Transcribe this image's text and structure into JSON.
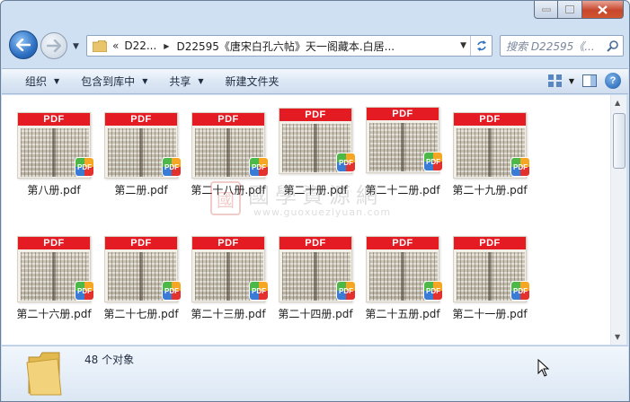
{
  "window": {
    "title_controls": {
      "minimize": "minimize",
      "maximize": "maximize",
      "close": "close"
    }
  },
  "nav": {
    "breadcrumb_overflow": "«",
    "breadcrumbs": [
      "D22...",
      "D22595《唐宋白孔六帖》天一阁藏本.白居..."
    ],
    "search_placeholder": "搜索 D22595《..."
  },
  "toolbar": {
    "items": [
      {
        "label": "组织",
        "has_menu": true
      },
      {
        "label": "包含到库中",
        "has_menu": true
      },
      {
        "label": "共享",
        "has_menu": true
      },
      {
        "label": "新建文件夹",
        "has_menu": false
      }
    ]
  },
  "files": [
    {
      "name": "第八册.pdf",
      "thumb_label": "PDF"
    },
    {
      "name": "第二册.pdf",
      "thumb_label": "PDF"
    },
    {
      "name": "第二十八册.pdf",
      "thumb_label": "PDF"
    },
    {
      "name": "第二十册.pdf",
      "thumb_label": "PDF"
    },
    {
      "name": "第二十二册.pdf",
      "thumb_label": "PDF"
    },
    {
      "name": "第二十九册.pdf",
      "thumb_label": "PDF"
    },
    {
      "name": "第二十六册.pdf",
      "thumb_label": "PDF"
    },
    {
      "name": "第二十七册.pdf",
      "thumb_label": "PDF"
    },
    {
      "name": "第二十三册.pdf",
      "thumb_label": "PDF"
    },
    {
      "name": "第二十四册.pdf",
      "thumb_label": "PDF"
    },
    {
      "name": "第二十五册.pdf",
      "thumb_label": "PDF"
    },
    {
      "name": "第二十一册.pdf",
      "thumb_label": "PDF"
    }
  ],
  "badge_label": "PDF",
  "watermark": {
    "seal": "國",
    "text": "國學資源網",
    "url": "www.guoxueziyuan.com"
  },
  "status": {
    "count_text": "48 个对象"
  },
  "colors": {
    "pdf_banner": "#e51b24",
    "window_frame": "#cfe0f3",
    "toolbar_text": "#1e2c40"
  }
}
